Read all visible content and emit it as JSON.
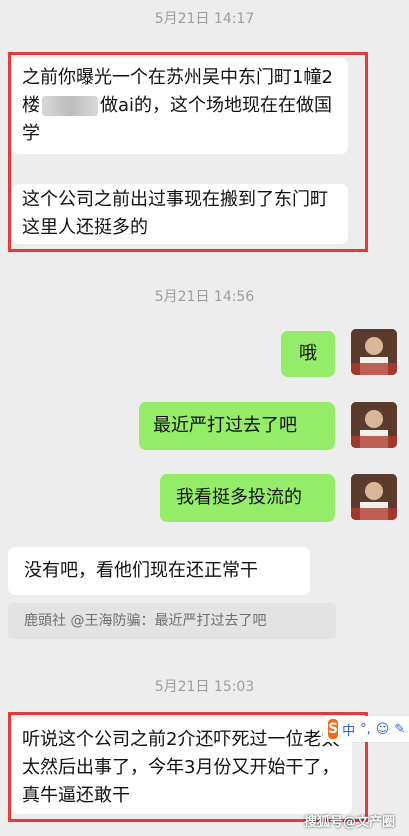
{
  "messages": {
    "ts1": "5月21日 14:17",
    "m1_a": "之前你曝光一个在苏州吴中东门町1幢2楼",
    "m1_b": "做ai的，这个场地现在在做国学",
    "m2": "这个公司之前出过事现在搬到了东门町这里人还挺多的",
    "ts2": "5月21日 14:56",
    "r1": "哦",
    "r2": "最近严打过去了吧",
    "r3": "我看挺多投流的",
    "m3": "没有吧，看他们现在还正常干",
    "quote": "鹿頭社 @王海防骗：最近严打过去了吧",
    "ts3": "5月21日 15:03",
    "m4": "听说这个公司之前2介还吓死过一位老太太然后出事了，今年3月份又开始干了，真牛逼还敢干"
  },
  "ime": {
    "logo": "S",
    "items": [
      "中",
      "°,",
      "☺",
      "✎"
    ]
  },
  "watermark": "搜狐号@文产圈",
  "colors": {
    "background": "#ededed",
    "outgoing_bubble": "#95ec69",
    "incoming_bubble": "#ffffff",
    "highlight_box": "#e23b3b"
  }
}
